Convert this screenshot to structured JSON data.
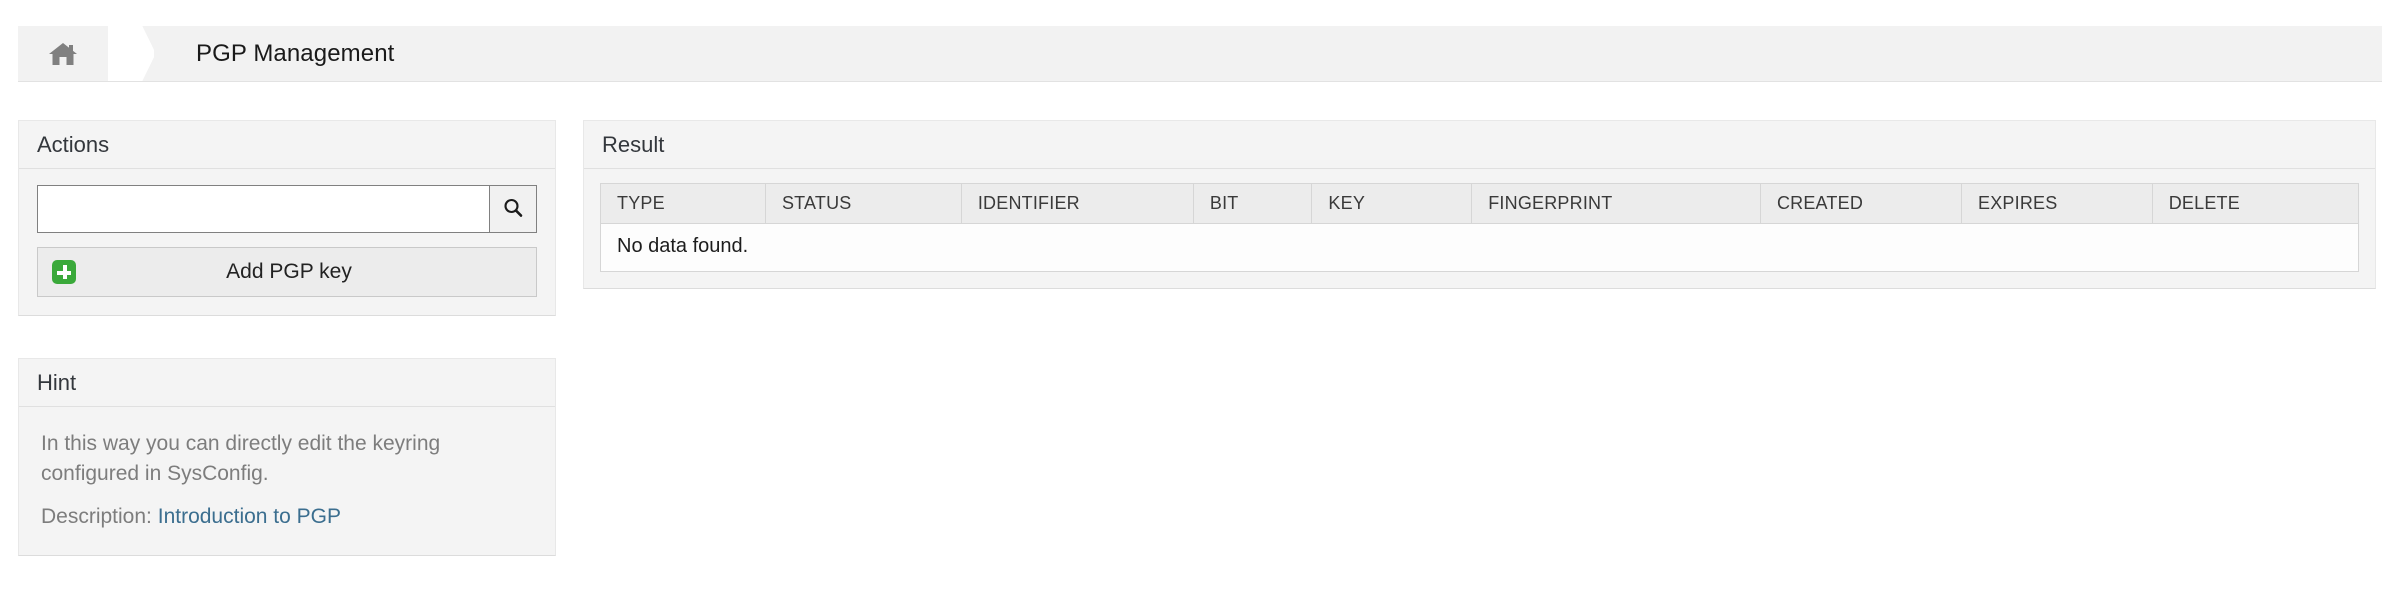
{
  "breadcrumb": {
    "home_icon": "home-icon",
    "separator_icon": "chevron-right-icon",
    "title": "PGP Management"
  },
  "actions": {
    "header": "Actions",
    "search": {
      "value": "",
      "placeholder": "",
      "button_icon": "search-icon"
    },
    "add_key": {
      "label": "Add PGP key",
      "icon": "plus-icon",
      "icon_color": "#3aa93a"
    }
  },
  "hint": {
    "header": "Hint",
    "body": "In this way you can directly edit the keyring configured in SysConfig.",
    "description_label": "Description:",
    "description_link": "Introduction to PGP",
    "link_color": "#3b6e8f"
  },
  "result": {
    "header": "Result",
    "columns": [
      "TYPE",
      "STATUS",
      "IDENTIFIER",
      "BIT",
      "KEY",
      "FINGERPRINT",
      "CREATED",
      "EXPIRES",
      "DELETE"
    ],
    "empty_message": "No data found.",
    "rows": []
  }
}
